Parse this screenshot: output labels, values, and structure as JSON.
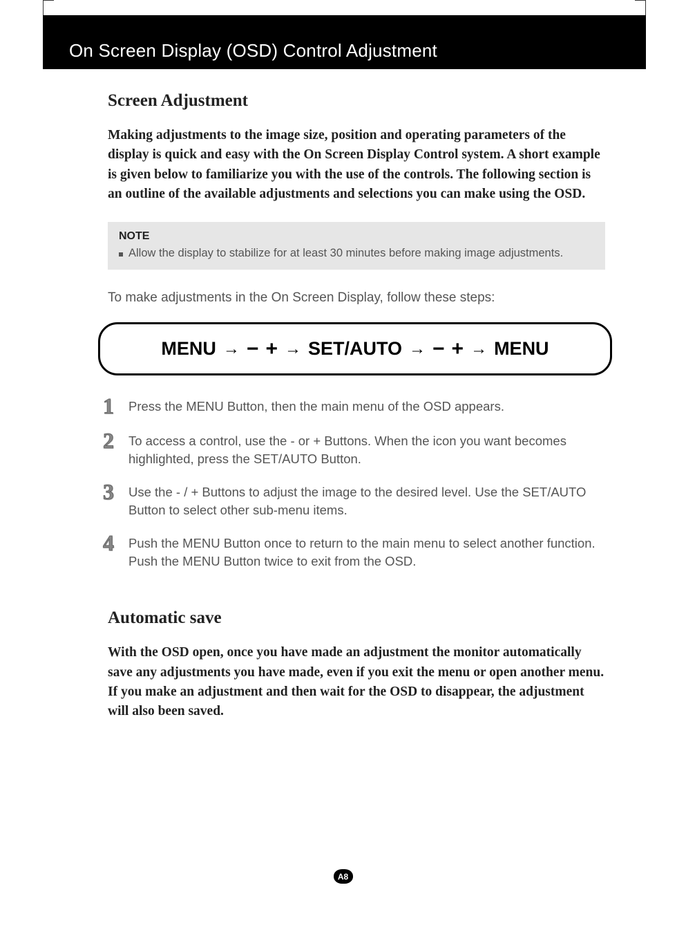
{
  "header": {
    "title": "On Screen Display (OSD) Control Adjustment"
  },
  "section1": {
    "title": "Screen Adjustment",
    "intro": "Making adjustments to the image size, position and operating parameters of the display is quick and easy with the On Screen Display Control system. A short example is given below to familiarize you with the use of the controls. The following section is an outline of the available adjustments and selections you can make using the OSD."
  },
  "note": {
    "label": "NOTE",
    "item": "Allow the display to stabilize for at least 30 minutes before making image adjustments."
  },
  "lead_in": "To make adjustments in the On Screen Display, follow these steps:",
  "flow": {
    "t1": "MENU",
    "minus": "−",
    "plus": "+",
    "t2": "SET/AUTO",
    "t3": "MENU"
  },
  "steps": [
    {
      "num": "1",
      "text": "Press the MENU Button, then the main menu of the OSD appears."
    },
    {
      "num": "2",
      "text": "To access a control, use the  -  or  +  Buttons. When the icon you want becomes highlighted, press the SET/AUTO Button."
    },
    {
      "num": "3",
      "text": " Use the  -   /  +   Buttons to adjust the image to the desired level. Use the SET/AUTO Button to select other sub-menu items."
    },
    {
      "num": "4",
      "text": "Push the MENU Button once to return to the main menu to select another function. Push the MENU Button twice to exit from the OSD."
    }
  ],
  "section2": {
    "title": "Automatic save",
    "body": "With the OSD open, once you have made an adjustment the monitor automatically save any adjustments you have made, even if you exit the menu or open another menu. If you make an adjustment and then wait for the OSD to disappear, the adjustment will also been saved."
  },
  "page_number": "A8"
}
